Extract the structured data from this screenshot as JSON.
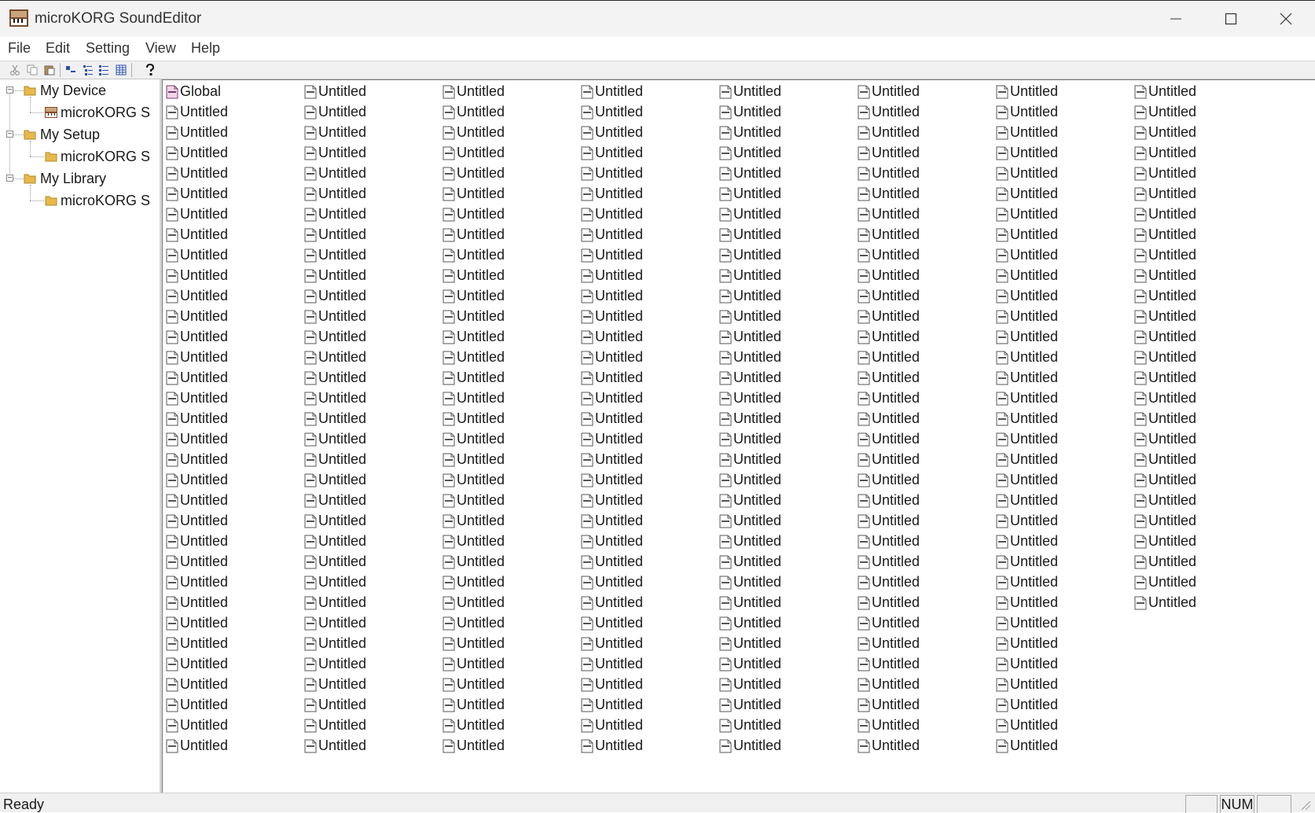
{
  "window": {
    "title": "microKORG SoundEditor",
    "icon": "app-icon",
    "controls": [
      "minimize-icon",
      "maximize-icon",
      "close-icon"
    ]
  },
  "menu": [
    "File",
    "Edit",
    "Setting",
    "View",
    "Help"
  ],
  "toolbar": [
    "cut-icon",
    "copy-icon",
    "paste-icon",
    "large-icons-icon",
    "list-view-icon",
    "details-view-icon",
    "table-view-icon",
    "help-icon"
  ],
  "tree": [
    {
      "label": "My Device",
      "expander": "−",
      "child": "microKORG S",
      "child_icon": "device-icon"
    },
    {
      "label": "My Setup",
      "expander": "−",
      "child": "microKORG S",
      "child_icon": "folder-icon"
    },
    {
      "label": "My Library",
      "expander": "−",
      "child": "microKORG S",
      "child_icon": "folder-icon"
    }
  ],
  "list": {
    "first_item": "Global",
    "item_label": "Untitled",
    "item_count": 257,
    "item_icon": "document-icon",
    "global_icon": "global-doc-icon"
  },
  "status": {
    "text": "Ready",
    "num": "NUM"
  },
  "colors": {
    "titlebar": "#f3f3f3",
    "folder": "#e8b84b",
    "background": "#ffffff"
  }
}
